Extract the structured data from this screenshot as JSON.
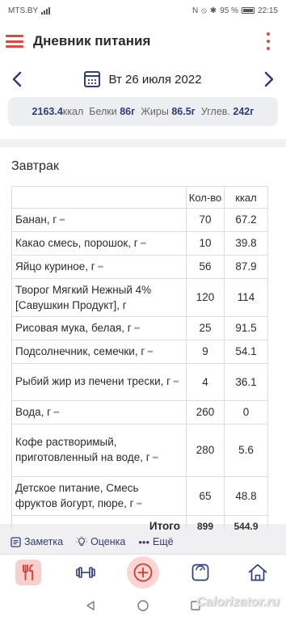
{
  "status": {
    "carrier": "MTS.BY",
    "battery": "95 %",
    "time": "22:15"
  },
  "app": {
    "title": "Дневник питания"
  },
  "date": {
    "label": "Вт 26 июля 2022"
  },
  "summary": {
    "kcal_value": "2163.4",
    "kcal_unit": "ккал",
    "protein_label": "Белки",
    "protein_value": "86г",
    "fat_label": "Жиры",
    "fat_value": "86.5г",
    "carbs_label": "Углев.",
    "carbs_value": "242г"
  },
  "meal": {
    "title": "Завтрак",
    "columns": {
      "qty": "Кол-во",
      "kcal": "ккал"
    },
    "rows": [
      {
        "name": "Банан, г",
        "qty": "70",
        "kcal": "67.2"
      },
      {
        "name": "Какао смесь, порошок, г",
        "qty": "10",
        "kcal": "39.8"
      },
      {
        "name": "Яйцо куриное, г",
        "qty": "56",
        "kcal": "87.9"
      },
      {
        "name": "Творог Мягкий Нежный 4% [Савушкин Продукт], г",
        "qty": "120",
        "kcal": "114"
      },
      {
        "name": "Рисовая мука, белая, г",
        "qty": "25",
        "kcal": "91.5"
      },
      {
        "name": "Подсолнечник, семечки, г",
        "qty": "9",
        "kcal": "54.1"
      },
      {
        "name": "Рыбий жир из печени трески, г",
        "qty": "4",
        "kcal": "36.1"
      },
      {
        "name": "Вода, г",
        "qty": "260",
        "kcal": "0"
      },
      {
        "name": "Кофе растворимый, приготовленный на воде, г",
        "qty": "280",
        "kcal": "5.6"
      },
      {
        "name": "Детское питание, Смесь фруктов йогурт, пюре, г",
        "qty": "65",
        "kcal": "48.8"
      }
    ],
    "total": {
      "label": "Итого",
      "qty": "899",
      "kcal": "544.9"
    }
  },
  "actions": {
    "note": "Заметка",
    "rating": "Оценка",
    "more": "Ещё"
  },
  "watermark": "Calorizator.ru",
  "colors": {
    "accent_red": "#e0493f",
    "accent_blue": "#2f3c7e"
  }
}
